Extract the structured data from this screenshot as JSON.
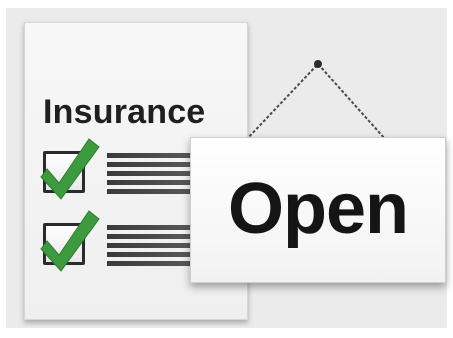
{
  "document": {
    "title": "Insurance",
    "items": [
      {
        "checked": true,
        "icon": "checkmark-icon"
      },
      {
        "checked": true,
        "icon": "checkmark-icon"
      }
    ]
  },
  "sign": {
    "label": "Open",
    "hanging": "chain-string"
  },
  "colors": {
    "check_green": "#3d9a3e",
    "background": "#ebebeb",
    "paper": "#f4f4f4",
    "text": "#1f1f1f"
  }
}
